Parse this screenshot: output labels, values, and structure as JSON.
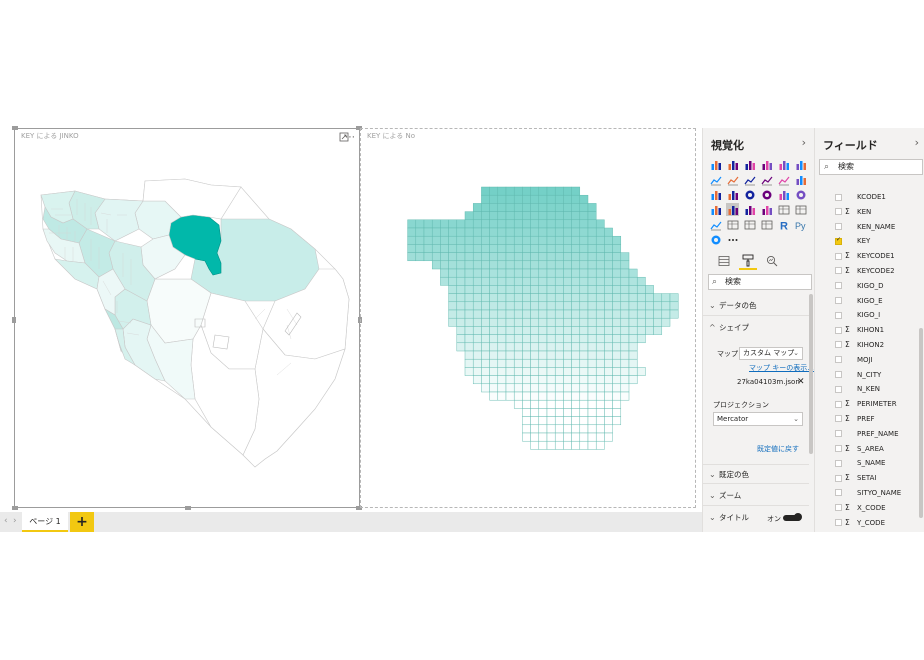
{
  "canvas": {
    "left_visual": {
      "title": "KEY による JINKO"
    },
    "right_visual": {
      "title": "KEY による No"
    }
  },
  "pages": {
    "tabs": [
      {
        "label": "ページ 1"
      }
    ],
    "add_label": "+"
  },
  "visualizations_pane": {
    "title": "視覚化",
    "search_placeholder": "検索",
    "sections": {
      "data_colors": "データの色",
      "shape": "シェイプ",
      "default_colors": "既定の色",
      "zoom": "ズーム",
      "title": "タイトル"
    },
    "map_label": "マップ",
    "map_value": "カスタム マップ",
    "map_keys_link": "マップ キーの表示...",
    "file_name": "27ka04103m.json",
    "projection_label": "プロジェクション",
    "projection_value": "Mercator",
    "revert_link": "既定値に戻す",
    "title_toggle_label": "オン"
  },
  "fields_pane": {
    "title": "フィールド",
    "search_placeholder": "検索",
    "fields": [
      {
        "name": "KCODE1",
        "sigma": false,
        "checked": false
      },
      {
        "name": "KEN",
        "sigma": true,
        "checked": false
      },
      {
        "name": "KEN_NAME",
        "sigma": false,
        "checked": false
      },
      {
        "name": "KEY",
        "sigma": false,
        "checked": true
      },
      {
        "name": "KEYCODE1",
        "sigma": true,
        "checked": false
      },
      {
        "name": "KEYCODE2",
        "sigma": true,
        "checked": false
      },
      {
        "name": "KIGO_D",
        "sigma": false,
        "checked": false
      },
      {
        "name": "KIGO_E",
        "sigma": false,
        "checked": false
      },
      {
        "name": "KIGO_I",
        "sigma": false,
        "checked": false
      },
      {
        "name": "KIHON1",
        "sigma": true,
        "checked": false
      },
      {
        "name": "KIHON2",
        "sigma": true,
        "checked": false
      },
      {
        "name": "MOJI",
        "sigma": false,
        "checked": false
      },
      {
        "name": "N_CITY",
        "sigma": false,
        "checked": false
      },
      {
        "name": "N_KEN",
        "sigma": false,
        "checked": false
      },
      {
        "name": "PERIMETER",
        "sigma": true,
        "checked": false
      },
      {
        "name": "PREF",
        "sigma": true,
        "checked": false
      },
      {
        "name": "PREF_NAME",
        "sigma": false,
        "checked": false
      },
      {
        "name": "S_AREA",
        "sigma": true,
        "checked": false
      },
      {
        "name": "S_NAME",
        "sigma": false,
        "checked": false
      },
      {
        "name": "SETAI",
        "sigma": true,
        "checked": false
      },
      {
        "name": "SITYO_NAME",
        "sigma": false,
        "checked": false
      },
      {
        "name": "X_CODE",
        "sigma": true,
        "checked": false
      },
      {
        "name": "Y_CODE",
        "sigma": true,
        "checked": false
      }
    ],
    "sigma_symbol": "Σ"
  },
  "colors": {
    "accent": "#f2c811",
    "highlight_region": "#01b8aa",
    "map_light": "#d6f1ee",
    "grid_dark": "#74d0c7",
    "grid_light": "#ffffff"
  }
}
